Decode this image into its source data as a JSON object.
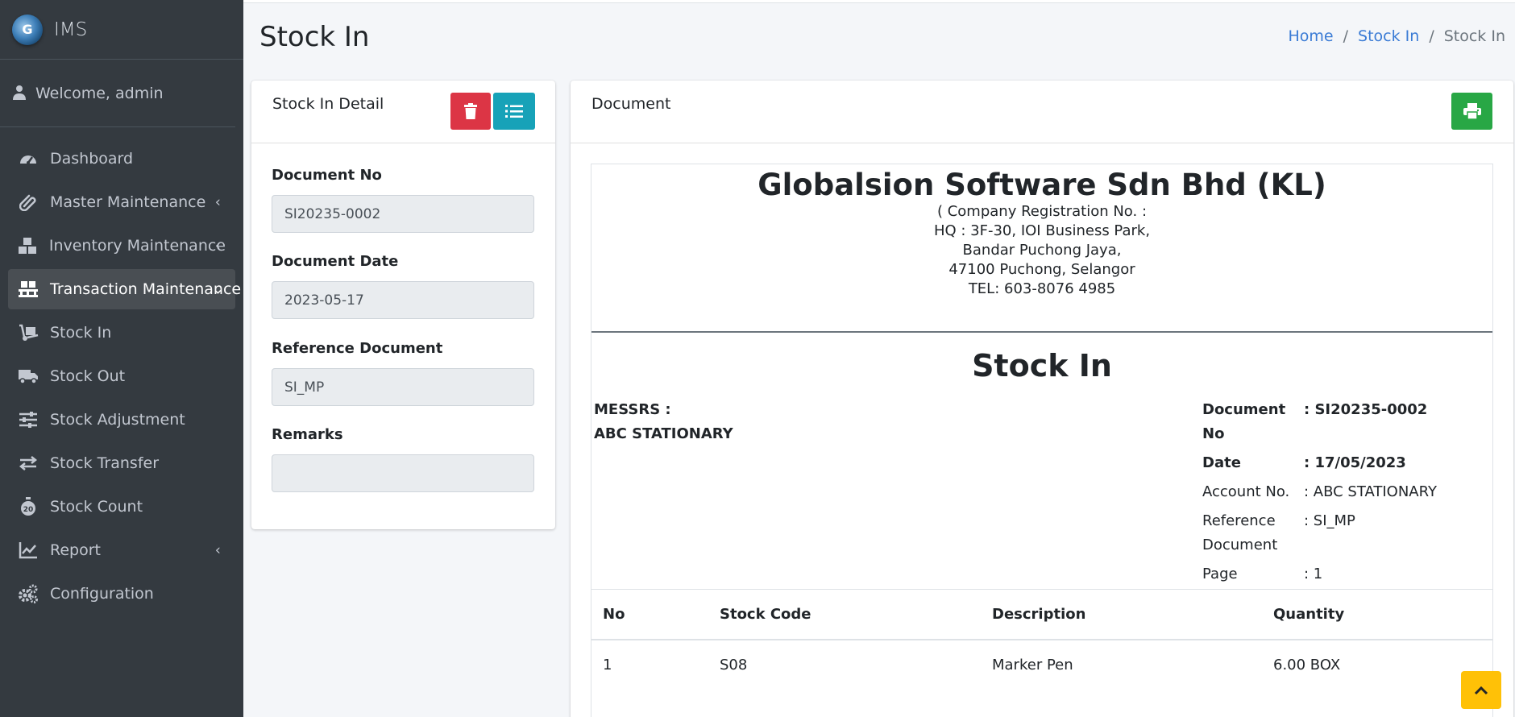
{
  "brand": {
    "name": "IMS"
  },
  "user": {
    "welcome": "Welcome, admin"
  },
  "sidebar": {
    "items": [
      {
        "label": "Dashboard",
        "icon": "tachometer-icon"
      },
      {
        "label": "Master Maintenance",
        "icon": "paperclip-icon",
        "expandable": true
      },
      {
        "label": "Inventory Maintenance",
        "icon": "boxes-icon",
        "expandable": true
      },
      {
        "label": "Transaction Maintenance",
        "icon": "pallet-icon",
        "expandable": true,
        "active": true
      },
      {
        "label": "Stock In",
        "icon": "dolly-icon"
      },
      {
        "label": "Stock Out",
        "icon": "truck-icon"
      },
      {
        "label": "Stock Adjustment",
        "icon": "sliders-icon"
      },
      {
        "label": "Stock Transfer",
        "icon": "exchange-icon"
      },
      {
        "label": "Stock Count",
        "icon": "stopwatch-icon"
      },
      {
        "label": "Report",
        "icon": "chart-line-icon",
        "expandable": true
      },
      {
        "label": "Configuration",
        "icon": "cogs-icon"
      }
    ]
  },
  "header": {
    "title": "Stock In",
    "breadcrumb": {
      "home": "Home",
      "parent": "Stock In",
      "current": "Stock In",
      "separator": "/"
    }
  },
  "detail": {
    "title": "Stock In Detail",
    "fields": {
      "doc_no_label": "Document No",
      "doc_no_value": "SI20235-0002",
      "doc_date_label": "Document Date",
      "doc_date_value": "2023-05-17",
      "ref_label": "Reference Document",
      "ref_value": "SI_MP",
      "remarks_label": "Remarks",
      "remarks_value": ""
    }
  },
  "document": {
    "title": "Document",
    "company": {
      "name": "Globalsion Software Sdn Bhd (KL)",
      "registration": "( Company Registration No. :",
      "address1": "HQ : 3F-30, IOI Business Park,",
      "address2": "Bandar Puchong Jaya,",
      "address3": "47100 Puchong, Selangor",
      "tel": "TEL: 603-8076 4985"
    },
    "doc_title": "Stock In",
    "messrs_label": "MESSRS :",
    "messrs_value": "ABC STATIONARY",
    "meta": {
      "doc_no_key": "Document No",
      "doc_no_val": ": SI20235-0002",
      "date_key": "Date",
      "date_val": ": 17/05/2023",
      "account_key": "Account No.",
      "account_val": ": ABC STATIONARY",
      "ref_key": "Reference Document",
      "ref_val": ": SI_MP",
      "page_key": "Page",
      "page_val": ": 1"
    },
    "table": {
      "headers": [
        "No",
        "Stock Code",
        "Description",
        "Quantity"
      ],
      "rows": [
        [
          "1",
          "S08",
          "Marker Pen",
          "6.00 BOX"
        ]
      ]
    }
  },
  "colors": {
    "sidebar_bg": "#343a40",
    "danger": "#dc3545",
    "info": "#17a2b8",
    "success": "#28a745",
    "warning": "#ffc107",
    "link": "#3a7bd5"
  }
}
